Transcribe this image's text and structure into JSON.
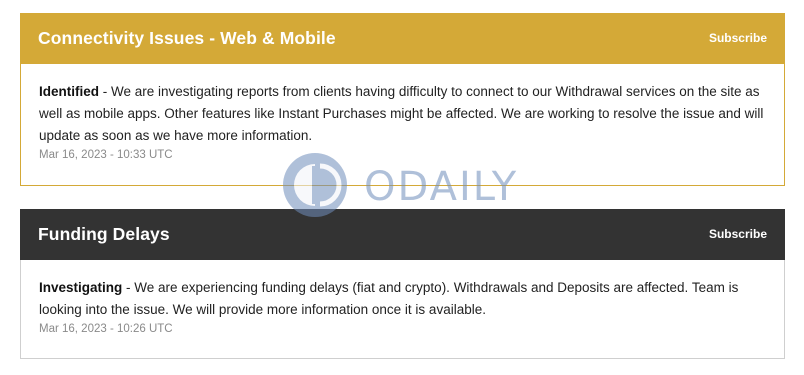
{
  "incidents": [
    {
      "title": "Connectivity Issues - Web & Mobile",
      "subscribe_label": "Subscribe",
      "status": "Identified",
      "message": " - We are investigating reports from clients having difficulty to connect to our Withdrawal services on the site as well as mobile apps. Other features like Instant Purchases might be affected. We are working to resolve the issue and will update as soon as we have more information.",
      "timestamp": "Mar 16, 2023 - 10:33 UTC",
      "header_color": "#d4a937"
    },
    {
      "title": "Funding Delays",
      "subscribe_label": "Subscribe",
      "status": "Investigating",
      "message": " - We are experiencing funding delays (fiat and crypto). Withdrawals and Deposits are affected. Team is looking into the issue. We will provide more information once it is available.",
      "timestamp": "Mar 16, 2023 - 10:26 UTC",
      "header_color": "#333333"
    }
  ],
  "watermark": {
    "text": "ODAILY",
    "icon": "odaily-logo-icon"
  }
}
